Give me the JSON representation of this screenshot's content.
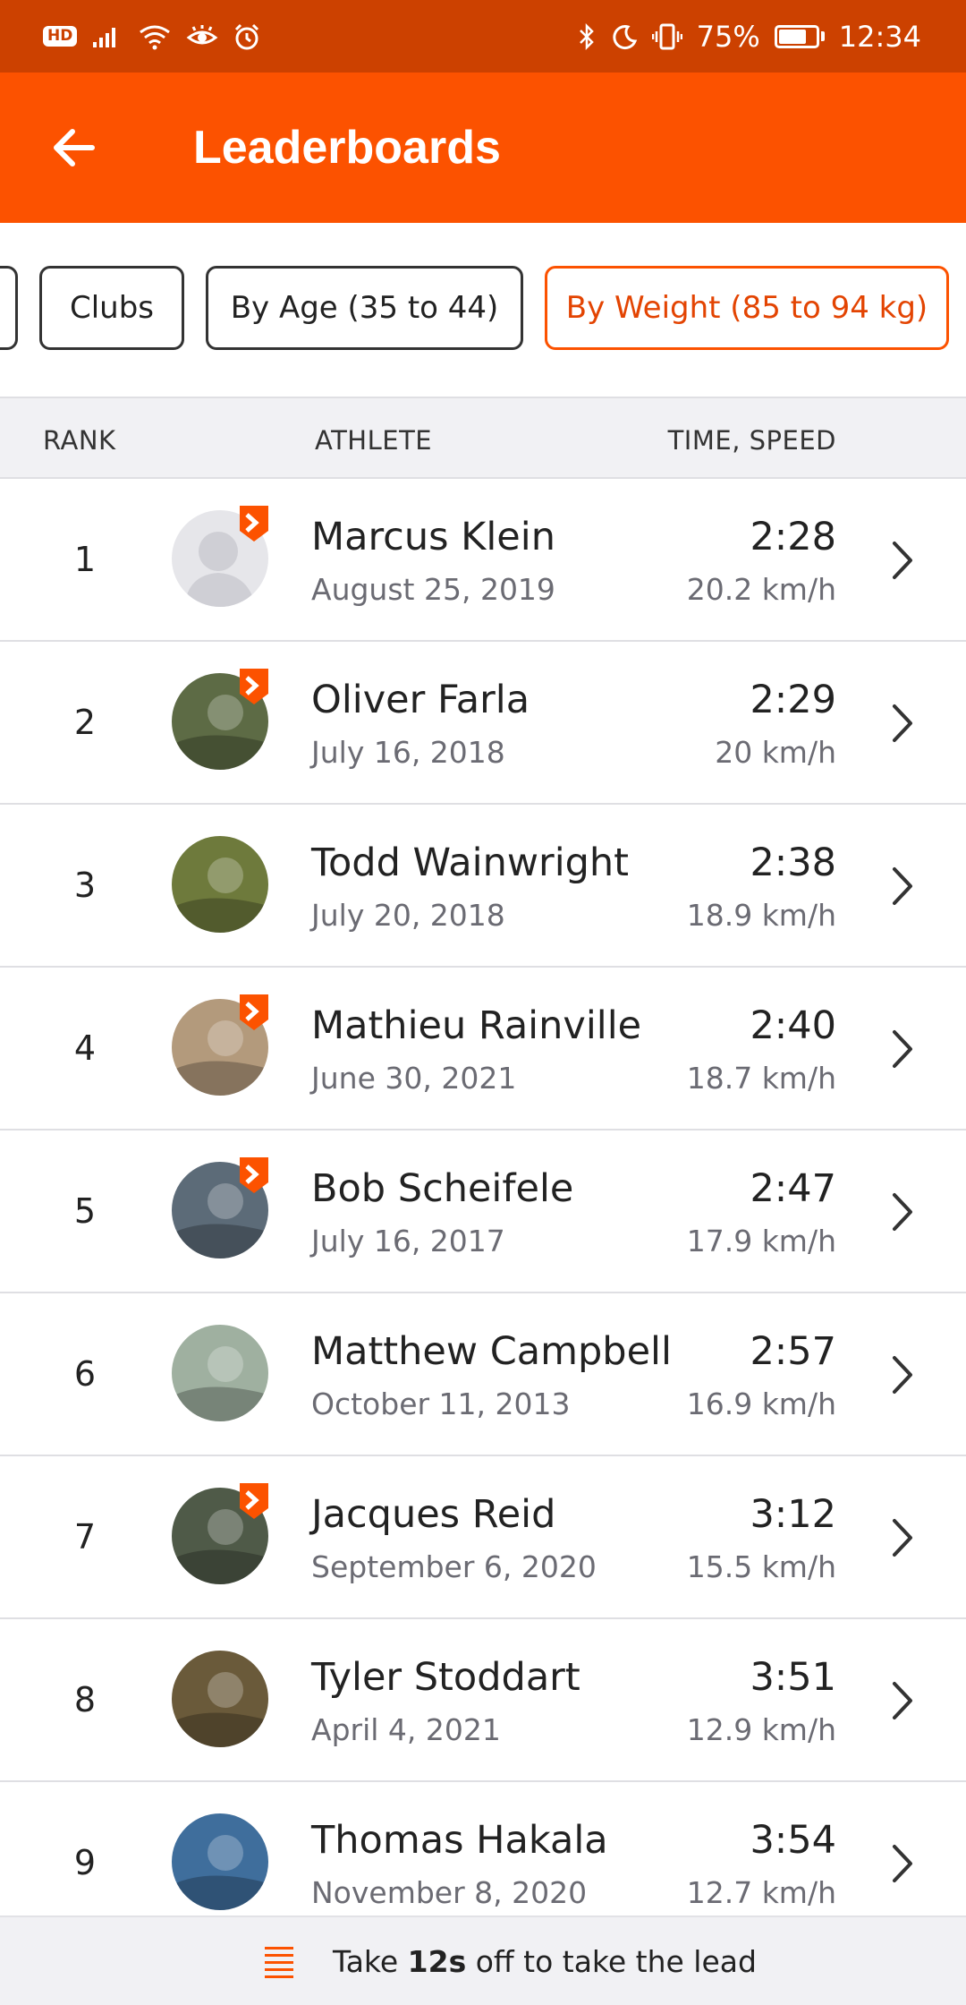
{
  "status_bar": {
    "hd": "HD",
    "battery": "75%",
    "time": "12:34",
    "icons": [
      "signal-icon",
      "wifi-icon",
      "eye-comfort-icon",
      "alarm-icon",
      "bluetooth-icon",
      "moon-icon",
      "vibrate-icon",
      "battery-icon"
    ]
  },
  "app_bar": {
    "title": "Leaderboards",
    "back_icon": "arrow-left-icon"
  },
  "filters": [
    {
      "label": "",
      "active": false
    },
    {
      "label": "Clubs",
      "active": false
    },
    {
      "label": "By Age (35 to 44)",
      "active": false
    },
    {
      "label": "By Weight (85 to 94 kg)",
      "active": true
    }
  ],
  "table_header": {
    "rank": "RANK",
    "athlete": "ATHLETE",
    "time_speed": "TIME, SPEED"
  },
  "rows": [
    {
      "rank": "1",
      "name": "Marcus Klein",
      "date": "August 25, 2019",
      "time": "2:28",
      "speed": "20.2 km/h",
      "subscriber_badge": true,
      "avatar_color": "#d8d8de"
    },
    {
      "rank": "2",
      "name": "Oliver Farla",
      "date": "July 16, 2018",
      "time": "2:29",
      "speed": "20 km/h",
      "subscriber_badge": true,
      "avatar_color": "#5d6b45"
    },
    {
      "rank": "3",
      "name": "Todd Wainwright",
      "date": "July 20, 2018",
      "time": "2:38",
      "speed": "18.9 km/h",
      "subscriber_badge": false,
      "avatar_color": "#6e7a3c"
    },
    {
      "rank": "4",
      "name": "Mathieu Rainville",
      "date": "June 30, 2021",
      "time": "2:40",
      "speed": "18.7 km/h",
      "subscriber_badge": true,
      "avatar_color": "#b39a7c"
    },
    {
      "rank": "5",
      "name": "Bob Scheifele",
      "date": "July 16, 2017",
      "time": "2:47",
      "speed": "17.9 km/h",
      "subscriber_badge": true,
      "avatar_color": "#5c6b78"
    },
    {
      "rank": "6",
      "name": "Matthew Campbell",
      "date": "October 11, 2013",
      "time": "2:57",
      "speed": "16.9 km/h",
      "subscriber_badge": false,
      "avatar_color": "#9fb0a0"
    },
    {
      "rank": "7",
      "name": "Jacques Reid",
      "date": "September 6, 2020",
      "time": "3:12",
      "speed": "15.5 km/h",
      "subscriber_badge": true,
      "avatar_color": "#4f5a48"
    },
    {
      "rank": "8",
      "name": "Tyler Stoddart",
      "date": "April 4, 2021",
      "time": "3:51",
      "speed": "12.9 km/h",
      "subscriber_badge": false,
      "avatar_color": "#6a5a3a"
    },
    {
      "rank": "9",
      "name": "Thomas Hakala",
      "date": "November 8, 2020",
      "time": "3:54",
      "speed": "12.7 km/h",
      "subscriber_badge": false,
      "avatar_color": "#3f6e9c"
    }
  ],
  "bottom_bar": {
    "prefix": "Take ",
    "bold": "12s",
    "suffix": " off to take the lead",
    "icon": "list-icon"
  },
  "colors": {
    "status_bar": "#cc4100",
    "brand": "#fc5200",
    "active_chip_text": "#e34402"
  }
}
